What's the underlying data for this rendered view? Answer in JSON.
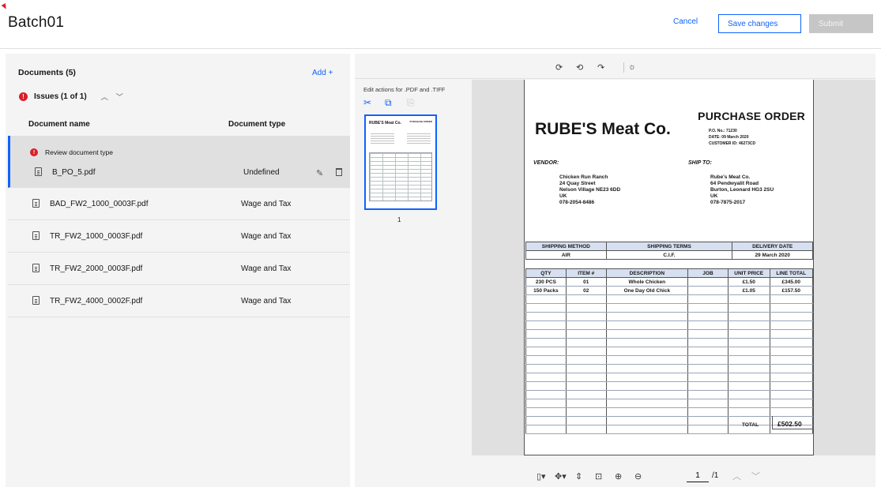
{
  "header": {
    "title": "Batch01",
    "cancel_label": "Cancel",
    "save_label": "Save changes",
    "submit_label": "Submit"
  },
  "documents": {
    "title": "Documents (5)",
    "add_label": "Add +",
    "issues_label": "Issues (1 of 1)",
    "col_name": "Document name",
    "col_type": "Document type",
    "review_text": "Review document type",
    "rows": [
      {
        "name": "B_PO_5.pdf",
        "type": "Undefined"
      },
      {
        "name": "BAD_FW2_1000_0003F.pdf",
        "type": "Wage and Tax"
      },
      {
        "name": "TR_FW2_1000_0003F.pdf",
        "type": "Wage and Tax"
      },
      {
        "name": "TR_FW2_2000_0003F.pdf",
        "type": "Wage and Tax"
      },
      {
        "name": "TR_FW2_4000_0002F.pdf",
        "type": "Wage and Tax"
      }
    ]
  },
  "viewer": {
    "edit_actions_label": "Edit actions for .PDF and .TIFF",
    "thumb_number": "1",
    "thumb_company": "RUBE'S Meat Co.",
    "thumb_po": "PURCHASE ORDER",
    "page_current": "1",
    "page_total": "/1",
    "document": {
      "po_title": "PURCHASE ORDER",
      "company": "RUBE'S Meat Co.",
      "po_no": "P.O. No.:  71230",
      "date": "DATE:   09 March 2020",
      "customer_id": "CUSTOMER ID:   46273CD",
      "vendor_label": "VENDOR:",
      "shipto_label": "SHIP TO:",
      "vendor_lines": [
        "Chicken Run Ranch",
        "24 Quay Street",
        "Nelson Village NE23 6DD",
        "UK",
        "078-2054-8486"
      ],
      "shipto_lines": [
        "Rube's Meat Co.",
        "64 Pendwyalit Road",
        "Burton, Leonard HG3 2SU",
        "UK",
        "078-7875-2017"
      ],
      "ship_headers": [
        "SHIPPING METHOD",
        "SHIPPING TERMS",
        "DELIVERY DATE"
      ],
      "ship_values": [
        "AIR",
        "C.I.F.",
        "29 March 2020"
      ],
      "item_headers": [
        "QTY",
        "ITEM #",
        "DESCRIPTION",
        "JOB",
        "UNIT PRICE",
        "LINE TOTAL"
      ],
      "items": [
        [
          "230 PCS",
          "01",
          "Whole Chicken",
          "",
          "£1.50",
          "£345.00"
        ],
        [
          "150 Packs",
          "02",
          "One Day Old Chick",
          "",
          "£1.05",
          "£157.50"
        ]
      ],
      "total_label": "TOTAL",
      "total_value": "£502.50"
    }
  }
}
